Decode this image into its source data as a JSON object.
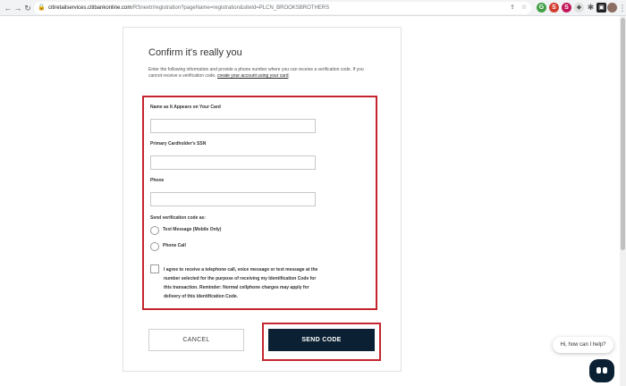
{
  "browser": {
    "url_host": "citiretailservices.citibankonline.com",
    "url_path": "/RSnextr/registration?pageName=registration&siteId=PLCN_BROOKSBROTHERS",
    "extensions": [
      {
        "letter": "S",
        "color": "#d23f31"
      },
      {
        "letter": "S",
        "color": "#c2185b"
      },
      {
        "letter": "B",
        "color": "#607d8b"
      }
    ]
  },
  "form": {
    "title": "Confirm it's really you",
    "intro_text": "Enter the following information and provide a phone number where you can receive a verification code. If you cannot receive a verification code,",
    "intro_link": "create your account using your card",
    "intro_end": ".",
    "name_label": "Name as It Appears on Your Card",
    "name_value": "",
    "ssn_label": "Primary Cardholder's SSN",
    "ssn_value": "",
    "phone_label": "Phone",
    "phone_value": "",
    "send_code_label": "Send verification code as:",
    "option_text": "Text Message (Mobile Only)",
    "option_call": "Phone Call",
    "consent_text": "I agree to receive a telephone call, voice message or text message at the number selected for the purpose of receiving my Identification Code for this transaction. Reminder: Normal cellphone charges may apply for delivery of this Identification Code.",
    "cancel_label": "CANCEL",
    "send_label": "SEND CODE"
  },
  "chat": {
    "greeting": "Hi, how can I help?"
  },
  "colors": {
    "highlight": "#c4262e",
    "primary_button": "#0b2033"
  }
}
